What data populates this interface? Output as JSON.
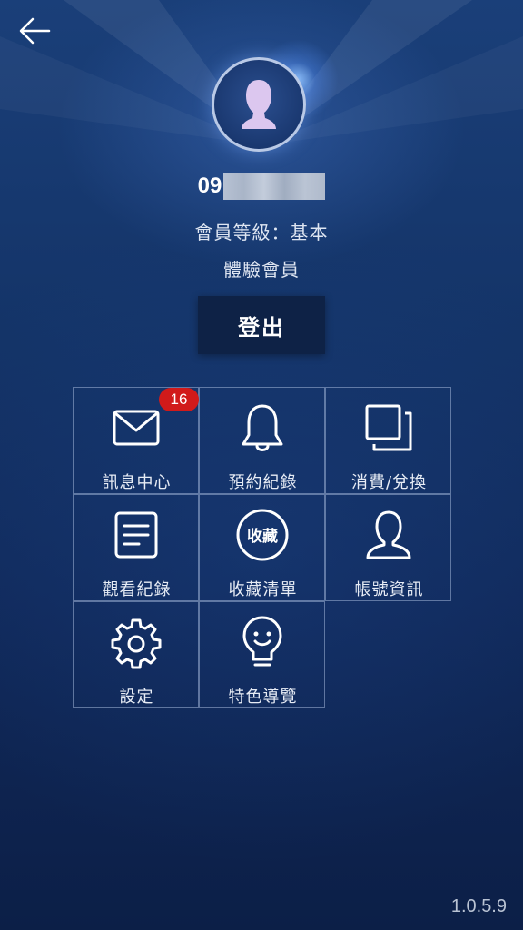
{
  "header": {
    "back_icon": "arrow-left-icon"
  },
  "profile": {
    "avatar_icon": "user-silhouette-icon",
    "phone_prefix": "09",
    "level_text": "會員等級：基本",
    "member_type": "體驗會員",
    "logout_label": "登出"
  },
  "menu": {
    "items": [
      {
        "label": "訊息中心",
        "icon": "mail-icon",
        "badge": "16"
      },
      {
        "label": "預約紀錄",
        "icon": "bell-icon"
      },
      {
        "label": "消費/兌換",
        "icon": "copy-icon"
      },
      {
        "label": "觀看紀錄",
        "icon": "document-icon"
      },
      {
        "label": "收藏清單",
        "icon": "favorites-icon",
        "icon_text": "收藏"
      },
      {
        "label": "帳號資訊",
        "icon": "user-icon"
      },
      {
        "label": "設定",
        "icon": "gear-icon"
      },
      {
        "label": "特色導覽",
        "icon": "lightbulb-icon"
      }
    ]
  },
  "footer": {
    "version": "1.0.5.9"
  }
}
